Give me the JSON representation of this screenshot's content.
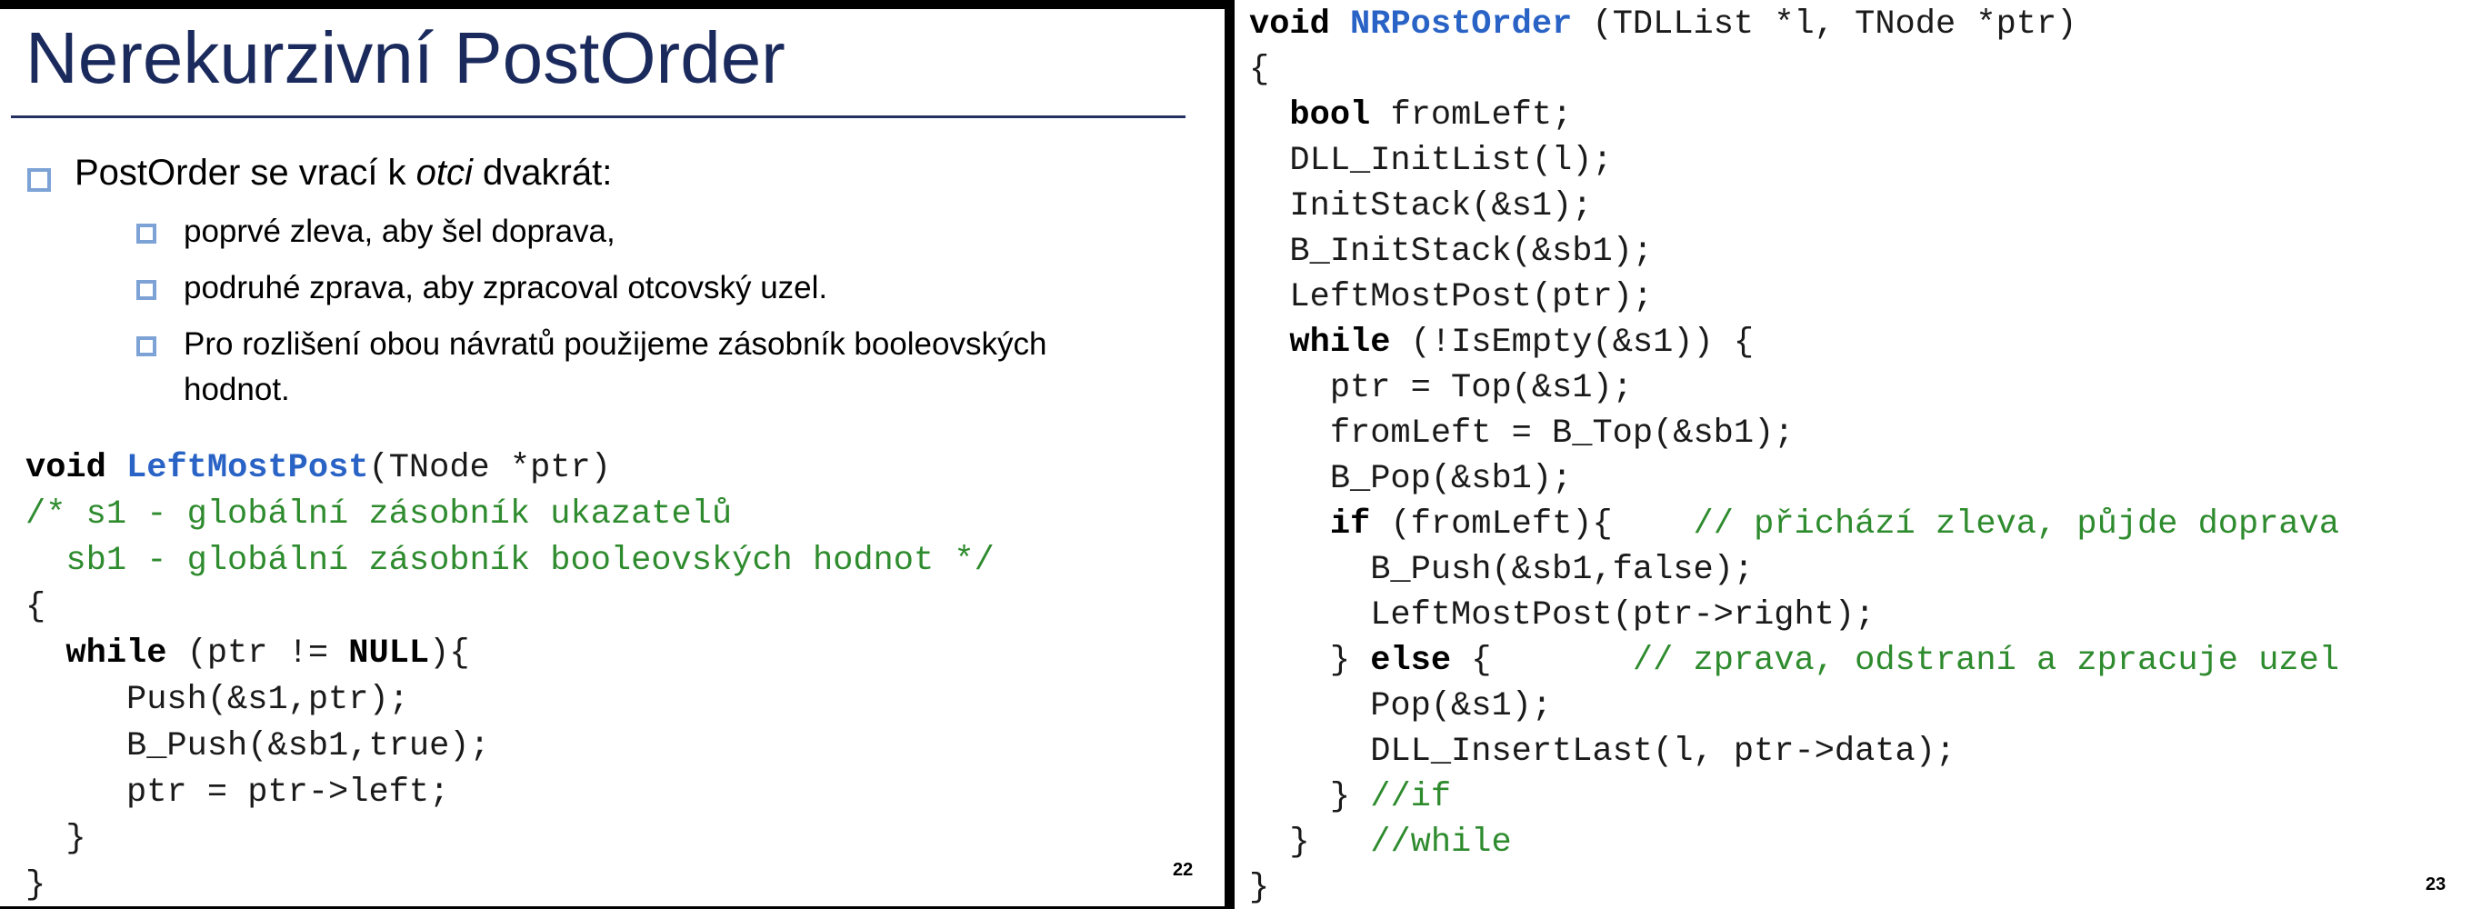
{
  "slide_left": {
    "title": "Nerekurzivní PostOrder",
    "bullet": {
      "prefix": "PostOrder se vrací k ",
      "emphasis": "otci",
      "suffix": " dvakrát:"
    },
    "sub_bullets": [
      "poprvé zleva, aby šel doprava,",
      "podruhé zprava, aby zpracoval otcovský uzel.",
      "Pro rozlišení obou návratů použijeme zásobník booleovských hodnot."
    ],
    "code": {
      "l1_kw": "void",
      "l1_fn": "LeftMostPost",
      "l1_rest": "(TNode *ptr)",
      "l2": "/* s1 - globální zásobník ukazatelů",
      "l3": "  sb1 - globální zásobník booleovských hodnot */",
      "l4": "{",
      "l5_kw": "while",
      "l5_a": " (ptr != ",
      "l5_null": "NULL",
      "l5_b": "){",
      "l6": "     Push(&s1,ptr);",
      "l7": "     B_Push(&sb1,true);",
      "l8": "     ptr = ptr->left;",
      "l9": "  }",
      "l10": "}"
    },
    "page_number": "22"
  },
  "slide_right": {
    "code": {
      "l1_kw": "void",
      "l1_fn": "NRPostOrder",
      "l1_rest": " (TDLList *l, TNode *ptr)",
      "l2": "{",
      "l3_kw": "bool",
      "l3_rest": " fromLeft;",
      "l4": "  DLL_InitList(l);",
      "l5": "  InitStack(&s1);",
      "l6": "  B_InitStack(&sb1);",
      "l7": "  LeftMostPost(ptr);",
      "l8_kw": "while",
      "l8_rest": " (!IsEmpty(&s1)) {",
      "l9": "    ptr = Top(&s1);",
      "l10": "    fromLeft = B_Top(&sb1);",
      "l11": "    B_Pop(&sb1);",
      "l12_kw": "if",
      "l12_rest": " (fromLeft){    ",
      "l12_cm": "// přichází zleva, půjde doprava",
      "l13": "      B_Push(&sb1,false);",
      "l14": "      LeftMostPost(ptr->right);",
      "l15_a": "    } ",
      "l15_kw": "else",
      "l15_b": " {       ",
      "l15_cm": "// zprava, odstraní a zpracuje uzel",
      "l16": "      Pop(&s1);",
      "l17": "      DLL_InsertLast(l, ptr->data);",
      "l18_a": "    } ",
      "l18_cm": "//if",
      "l19_a": "  }   ",
      "l19_cm": "//while",
      "l20": "}"
    },
    "page_number": "23"
  }
}
